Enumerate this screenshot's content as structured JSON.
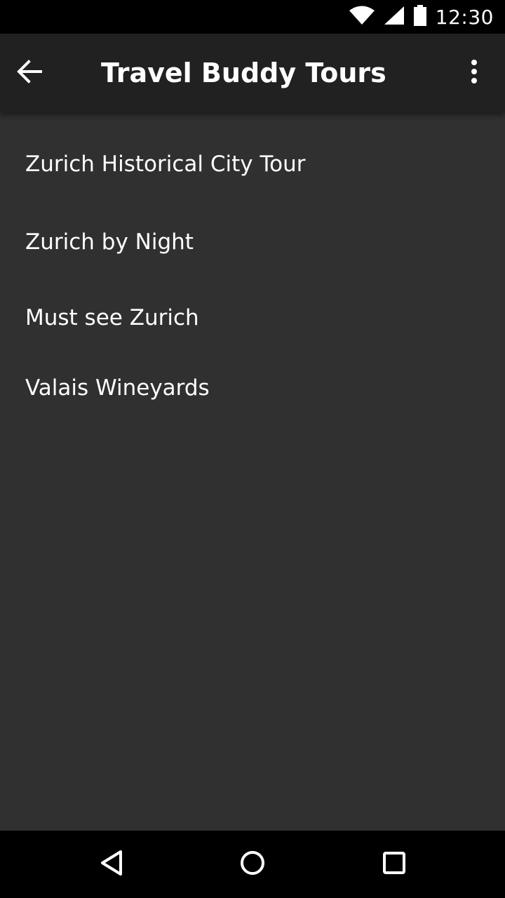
{
  "status_bar": {
    "time": "12:30",
    "icons": [
      "wifi-icon",
      "cell-signal-icon",
      "battery-icon"
    ]
  },
  "toolbar": {
    "title": "Travel Buddy Tours",
    "back_icon": "arrow-back-icon",
    "menu_icon": "more-vert-icon"
  },
  "tours": [
    {
      "label": "Zurich Historical City Tour"
    },
    {
      "label": "Zurich by Night"
    },
    {
      "label": "Must see Zurich"
    },
    {
      "label": "Valais Wineyards"
    }
  ],
  "nav_bar": {
    "icons": [
      "back-triangle-icon",
      "home-circle-icon",
      "recents-square-icon"
    ]
  },
  "colors": {
    "background": "#303030",
    "toolbar": "#212121",
    "system_bars": "#000000",
    "text": "#ffffff"
  }
}
